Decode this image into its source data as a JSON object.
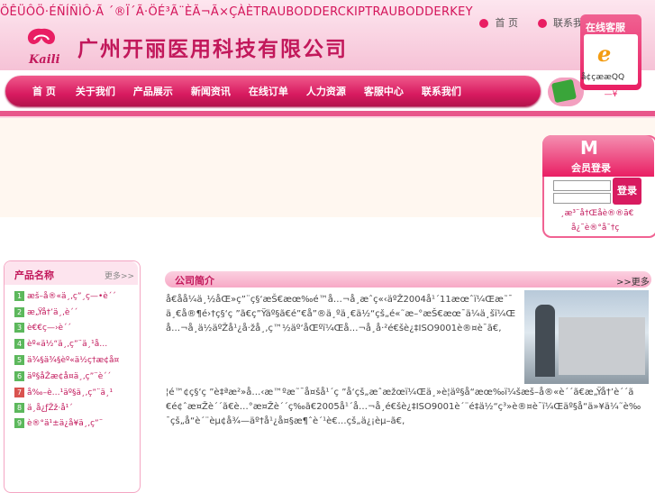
{
  "header": {
    "garble_top": "ÖÊÜÔÖ·ÉÑÍÑÌÔ·Ã ´®Ï´Ã·ÖÉ³Ã¨ÈÃ¬Ã×ÇÀÈTRAUBODDERCKIPTRAUBODDERKEY",
    "company_name": "广州开丽医用科技有限公司",
    "logo_text": "Kaili",
    "toplinks": [
      "首 页",
      "联系我们"
    ]
  },
  "nav": {
    "items": [
      "首  页",
      "关于我们",
      "产品展示",
      "新闻资讯",
      "在线订单",
      "人力资源",
      "客服中心",
      "联系我们"
    ]
  },
  "service": {
    "title": "在线客服",
    "qq": "å¢çææQQ",
    "footer": "—¥"
  },
  "login": {
    "m": "M",
    "title": "会员登录",
    "button": "登录",
    "link1": "¸æ³¨å†Œåè®®ã€",
    "link2": "å¿˜è®°å¯†ç "
  },
  "sidebar": {
    "title": "产品名称",
    "more": "更多>>",
    "items": [
      {
        "num": "1",
        "text": "æš–å®«ä¸‚ç”¸ç—•è´´",
        "red": false
      },
      {
        "num": "2",
        "text": "æ„Ÿå†’ä¸‚è´´",
        "red": false
      },
      {
        "num": "3",
        "text": "è€€ç—›è´´",
        "red": false
      },
      {
        "num": "4",
        "text": "èº«ä½“ä¸‚ç”¨ä¸¹å…",
        "red": false
      },
      {
        "num": "5",
        "text": "ä¾§ä¾§èº«ä½ç†æ¢å¤",
        "red": false
      },
      {
        "num": "6",
        "text": "äº§åŽæ¢å¤ä¸‚ç”¨è´´",
        "red": false
      },
      {
        "num": "7",
        "text": "å‰–è…¹äº§ä¸‚ç”¨ä¸¹",
        "red": true
      },
      {
        "num": "8",
        "text": "ä¸å¿ƒŽž·å¹´",
        "red": false
      },
      {
        "num": "9",
        "text": "è®°ä¹±ä¿å¥ä¸‚ç”¨",
        "red": false
      }
    ]
  },
  "main": {
    "title": "公司简介",
    "more": ">>更多",
    "text1": "å€åå¼ä¸½åŒ»ç”¨ç§‘æŠ€æœ‰é™å…¬å¸æˆç«‹äºŽ2004å¹´11æœˆï¼Œæ˜¯ä¸€å®¶é›†ç§‘ç ”ã€ç”Ÿäº§ã€é”€å”®ä¸ºä¸€ä½“çš„é«˜æ–°æŠ€æœ¯ä¼ä¸šï¼Œå…¬å¸ä½äºŽå¹¿å·žå¸‚ç™½äº‘åŒºï¼Œå…¬å¸å·²é€šè¿‡ISO9001è®¤è¯ã€‚",
    "text2": "¦é™¢ç§‘ç ”è‡ªæ²»å…‹æ™ºæ˜¯å¤šå¹´ç ”å‘çš„æˆæžœï¼Œä¸»è¦äº§å“æœ‰ï¼šæš–å®«è´´ã€æ„Ÿå†’è´´ã€é¢ˆæ¤Žè´´ã€è…°æ¤Žè´´ç­‰ã€2005å¹´å…¬å¸é€šè¿‡ISO9001è´¨é‡ä½“ç³»è®¤è¯ï¼Œäº§å“ä»¥ä¼˜è‰¯çš„å“è´¨èµ¢å¾—äº†å¹¿å¤§æ¶ˆè´¹è€…çš„ä¿¡èµ–ã€‚"
  }
}
